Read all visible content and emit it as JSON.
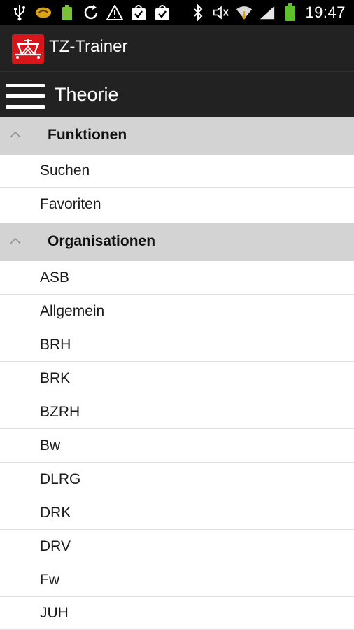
{
  "status_bar": {
    "time": "19:47",
    "icons_left": [
      "usb-icon",
      "app-badge-icon",
      "battery-app-icon",
      "sync-icon",
      "warning-icon",
      "shopping-bag-check-icon",
      "shopping-bag-check-icon"
    ],
    "icons_right": [
      "bluetooth-icon",
      "mute-icon",
      "wifi-icon",
      "signal-icon",
      "battery-icon"
    ]
  },
  "app_bar": {
    "title": "TZ-Trainer",
    "logo_color": "#d6161a"
  },
  "sub_bar": {
    "title": "Theorie",
    "menu_icon": "hamburger-menu-icon"
  },
  "groups": [
    {
      "label": "Funktionen",
      "items": [
        "Suchen",
        "Favoriten"
      ]
    },
    {
      "label": "Organisationen",
      "items": [
        "ASB",
        "Allgemein",
        "BRH",
        "BRK",
        "BZRH",
        "Bw",
        "DLRG",
        "DRK",
        "DRV",
        "Fw",
        "JUH"
      ]
    }
  ],
  "colors": {
    "status_bar_bg": "#000000",
    "app_bar_bg": "#222222",
    "group_header_bg": "#d3d3d3",
    "list_bg": "#ffffff",
    "battery_green": "#5cc12b"
  }
}
